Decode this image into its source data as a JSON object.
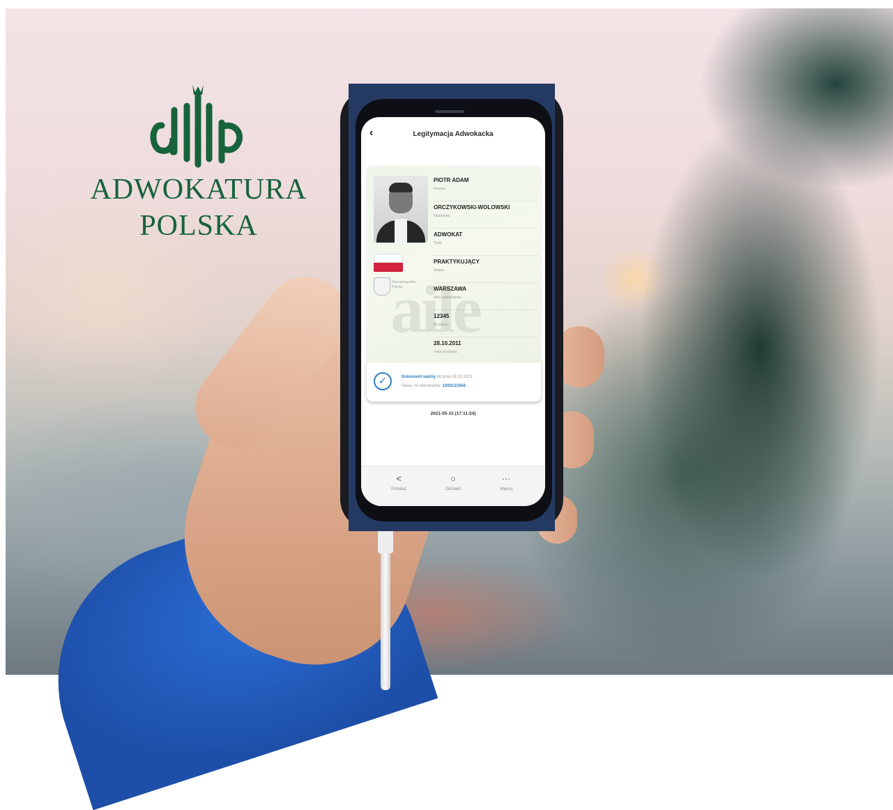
{
  "brand": {
    "line1": "ADWOKATURA",
    "line2": "POLSKA",
    "color": "#17633c"
  },
  "screen": {
    "title": "Legitymacja Adwokacka",
    "back_icon": "chevron-left-icon"
  },
  "card": {
    "watermark": "aile",
    "fields": [
      {
        "value": "PIOTR ADAM",
        "label": "Imiona"
      },
      {
        "value": "ORCZYKOWSKI-WOLOWSKI",
        "label": "Nazwisko"
      },
      {
        "value": "ADWOKAT",
        "label": "Tytuł"
      },
      {
        "value": "PRAKTYKUJĄCY",
        "label": "Status"
      },
      {
        "value": "WARSZAWA",
        "label": "Izba adwokacka"
      },
      {
        "value": "12345",
        "label": "Nr wpisu"
      },
      {
        "value": "28.10.2011",
        "label": "Data wydania"
      }
    ],
    "emblem_text": "Rzeczpospolita Polska"
  },
  "validity": {
    "valid_label": "Dokument ważny",
    "valid_until": "do dnia 28.10.2021",
    "series_label": "Seria i nr dokumentu:",
    "series_value": "1000123456",
    "accent": "#2d7fc4"
  },
  "timestamp": "2021-05-15 (17:11:54)",
  "tabbar": [
    {
      "label": "Przekaż",
      "icon": "share-icon"
    },
    {
      "label": "Odśwież",
      "icon": "refresh-icon"
    },
    {
      "label": "Więcej",
      "icon": "more-icon"
    }
  ]
}
